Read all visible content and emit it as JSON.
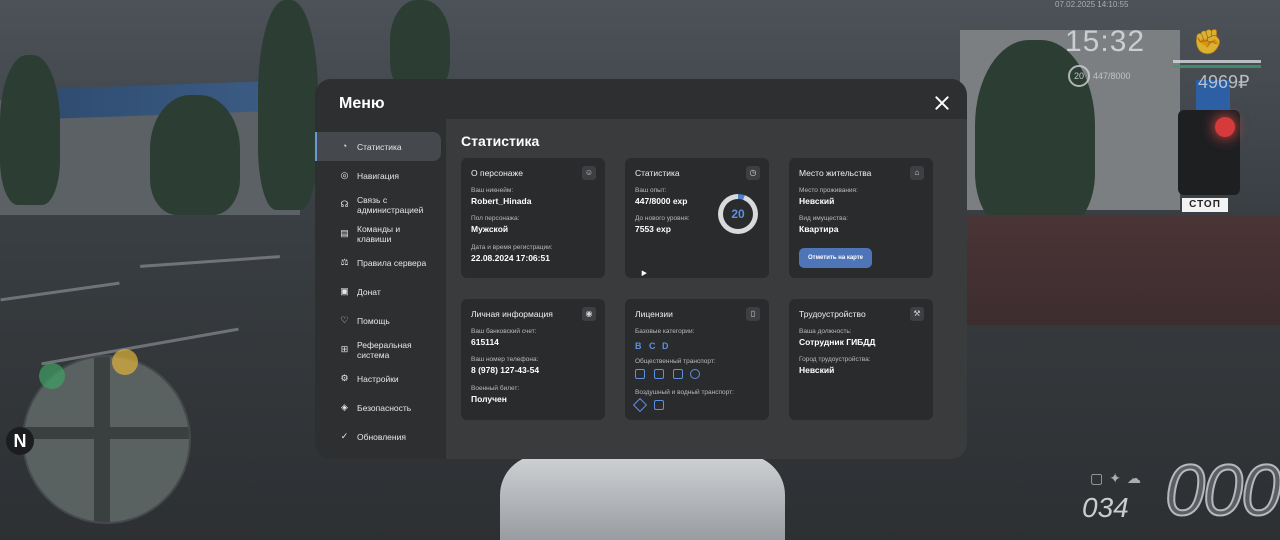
{
  "hud": {
    "date_small": "07.02.2025 14:10:55",
    "time": "15:32",
    "level": "20",
    "exp": "447/8000",
    "money": "4969₽",
    "speed": "000",
    "fuel": "034",
    "stop_sign": "СТОП",
    "compass": "N"
  },
  "menu": {
    "title": "Меню",
    "nav": [
      {
        "label": "Статистика",
        "icon": "pie-chart-icon",
        "glyph": "◔"
      },
      {
        "label": "Навигация",
        "icon": "compass-icon",
        "glyph": "◎"
      },
      {
        "label": "Связь с администрацией",
        "icon": "headset-icon",
        "glyph": "☊"
      },
      {
        "label": "Команды и клавиши",
        "icon": "document-icon",
        "glyph": "▤"
      },
      {
        "label": "Правила сервера",
        "icon": "scales-icon",
        "glyph": "⚖"
      },
      {
        "label": "Донат",
        "icon": "wallet-icon",
        "glyph": "▣"
      },
      {
        "label": "Помощь",
        "icon": "heart-hand-icon",
        "glyph": "♡"
      },
      {
        "label": "Реферальная система",
        "icon": "share-icon",
        "glyph": "⊞"
      },
      {
        "label": "Настройки",
        "icon": "gear-icon",
        "glyph": "⚙"
      },
      {
        "label": "Безопасность",
        "icon": "shield-icon",
        "glyph": "◈"
      },
      {
        "label": "Обновления",
        "icon": "check-circle-icon",
        "glyph": "✓"
      }
    ]
  },
  "content": {
    "title": "Статистика",
    "character": {
      "title": "О персонаже",
      "icon": "user-icon",
      "nickname_label": "Ваш никнейм:",
      "nickname": "Robert_Hinada",
      "gender_label": "Пол персонажа:",
      "gender": "Мужской",
      "reg_label": "Дата и время регистрации:",
      "reg_date": "22.08.2024 17:06:51"
    },
    "stats": {
      "title": "Статистика",
      "icon": "clock-icon",
      "exp_label": "Ваш опыт:",
      "exp": "447/8000 exp",
      "next_label": "До нового уровня:",
      "next": "7553 exp",
      "level": "20",
      "progress_fraction": 0.056
    },
    "residence": {
      "title": "Место жительства",
      "icon": "home-icon",
      "place_label": "Место проживания:",
      "place": "Невский",
      "property_label": "Вид имущества:",
      "property": "Квартира",
      "map_button": "Отметить на карте"
    },
    "personal": {
      "title": "Личная информация",
      "icon": "fingerprint-icon",
      "bank_label": "Ваш банковский счет:",
      "bank": "615114",
      "phone_label": "Ваш номер телефона:",
      "phone": "8 (978) 127-43-54",
      "military_label": "Военный билет:",
      "military": "Получен"
    },
    "licenses": {
      "title": "Лицензии",
      "icon": "id-card-icon",
      "basic_label": "Базовые категории:",
      "basic": [
        "B",
        "C",
        "D"
      ],
      "public_label": "Общественный транспорт:",
      "public_icons": [
        "bus-icon",
        "trolleybus-icon",
        "tram-icon",
        "taxi-icon"
      ],
      "air_label": "Воздушный и водный транспорт:",
      "air_icons": [
        "plane-icon",
        "boat-icon"
      ]
    },
    "employment": {
      "title": "Трудоустройство",
      "icon": "hammer-icon",
      "position_label": "Ваша должность:",
      "position": "Сотрудник ГИБДД",
      "city_label": "Город трудоустройства:",
      "city": "Невский"
    }
  }
}
